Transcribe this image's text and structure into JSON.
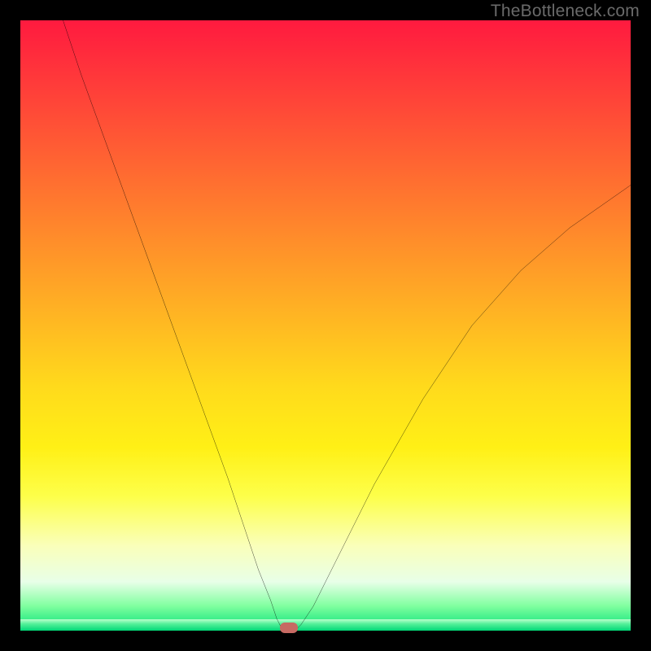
{
  "watermark": "TheBottleneck.com",
  "colors": {
    "frame": "#000000",
    "gradient_top": "#ff1a3f",
    "gradient_mid": "#ffda1c",
    "gradient_bottom": "#00e078",
    "curve": "#000000",
    "min_marker": "#c76a63"
  },
  "chart_data": {
    "type": "line",
    "title": "",
    "xlabel": "",
    "ylabel": "",
    "xlim": [
      0,
      100
    ],
    "ylim": [
      0,
      100
    ],
    "min_marker": {
      "x": 44,
      "y": 0
    },
    "series": [
      {
        "name": "bottleneck-curve",
        "x": [
          7,
          10,
          14,
          18,
          22,
          26,
          30,
          34,
          37,
          39,
          41,
          42,
          43,
          45,
          46,
          48,
          52,
          58,
          66,
          74,
          82,
          90,
          100
        ],
        "y": [
          100,
          91,
          80,
          69,
          58,
          47,
          36,
          25,
          16,
          10,
          5,
          2,
          0,
          0,
          1,
          4,
          12,
          24,
          38,
          50,
          59,
          66,
          73
        ]
      }
    ]
  }
}
